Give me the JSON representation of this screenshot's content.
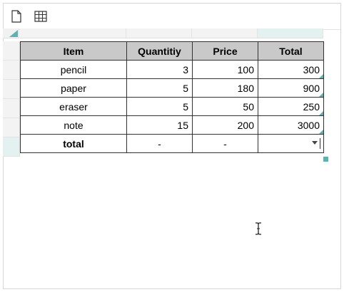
{
  "toolbar": {
    "new_icon": "new-document-icon",
    "table_icon": "insert-table-icon"
  },
  "table": {
    "headers": [
      "Item",
      "Quantitiy",
      "Price",
      "Total"
    ],
    "rows": [
      {
        "item": "pencil",
        "quantity": "3",
        "price": "100",
        "total": "300"
      },
      {
        "item": "paper",
        "quantity": "5",
        "price": "180",
        "total": "900"
      },
      {
        "item": "eraser",
        "quantity": "5",
        "price": "50",
        "total": "250"
      },
      {
        "item": "note",
        "quantity": "15",
        "price": "200",
        "total": "3000"
      }
    ],
    "footer": {
      "item": "total",
      "quantity": "-",
      "price": "-",
      "total": ""
    }
  },
  "colors": {
    "header_bg": "#c9c9c9",
    "accent": "#5fb1b1",
    "active_header": "#e4f1f1"
  }
}
